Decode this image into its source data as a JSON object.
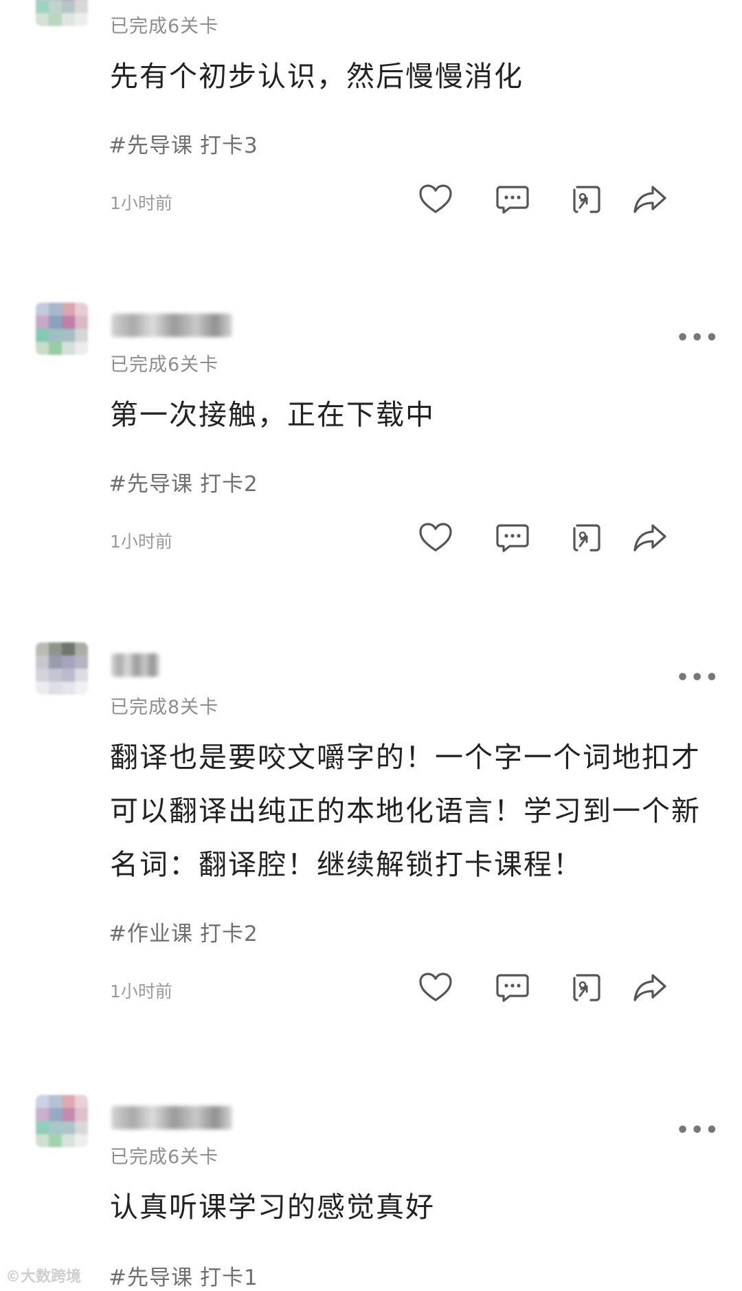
{
  "posts": [
    {
      "progress": "已完成6关卡",
      "content": "先有个初步认识，然后慢慢消化",
      "tags": [
        "#先导课",
        "打卡3"
      ],
      "time": "1小时前",
      "avatar_colors": [
        "#cfd6e8",
        "#c9d3c6",
        "#d7cbd6",
        "#e2d0d8",
        "#d2c4d9",
        "#a9b7c9",
        "#c48db2",
        "#d9c4d0",
        "#9fd2c1",
        "#c4d2ce",
        "#b5c6c8",
        "#d8d8d8",
        "#d5e0d6",
        "#b9d7bf",
        "#e1e5e2",
        "#ededed"
      ]
    },
    {
      "progress": "已完成6关卡",
      "content": "第一次接触，正在下载中",
      "tags": [
        "#先导课",
        "打卡2"
      ],
      "time": "1小时前",
      "avatar_colors": [
        "#c4c9de",
        "#a9b6cc",
        "#d8a6ad",
        "#e6cdd3",
        "#c6a8c8",
        "#8da0bd",
        "#c07ea9",
        "#d9b9c6",
        "#83c9b3",
        "#9fbfc2",
        "#a6bec4",
        "#d6d6d6",
        "#c8dcc9",
        "#98cca3",
        "#d7dfd9",
        "#ececec"
      ]
    },
    {
      "progress": "已完成8关卡",
      "content": "翻译也是要咬文嚼字的！一个字一个词地扣才可以翻译出纯正的本地化语言！学习到一个新名词：翻译腔！继续解锁打卡课程！",
      "tags": [
        "#作业课",
        "打卡2"
      ],
      "time": "1小时前",
      "avatar_colors": [
        "#b9bcb3",
        "#8f968b",
        "#6f786b",
        "#a9ada6",
        "#c7c7cc",
        "#999bb0",
        "#a5a6bd",
        "#b5b4bf",
        "#d3d3db",
        "#c4c4d6",
        "#b9bacc",
        "#dcdce2",
        "#ececef",
        "#dedee6",
        "#e5e5ea",
        "#f1f1f4"
      ]
    },
    {
      "progress": "已完成6关卡",
      "content": "认真听课学习的感觉真好",
      "tags": [
        "#先导课",
        "打卡1"
      ],
      "time": "",
      "avatar_colors": [
        "#cbd1e6",
        "#b5c1d3",
        "#dba9b0",
        "#e8d1d6",
        "#cbb0cd",
        "#98a9c4",
        "#c58ab0",
        "#ddc0cc",
        "#8fcfb9",
        "#a9c7c9",
        "#aec4c9",
        "#d8d8d8",
        "#cee0cf",
        "#a2d2ac",
        "#dae2dc",
        "#eeeeee"
      ]
    }
  ],
  "more_label": "•••",
  "icons": [
    "heart-icon",
    "comment-icon",
    "repost-icon",
    "share-icon"
  ],
  "watermark": "©大数跨境"
}
